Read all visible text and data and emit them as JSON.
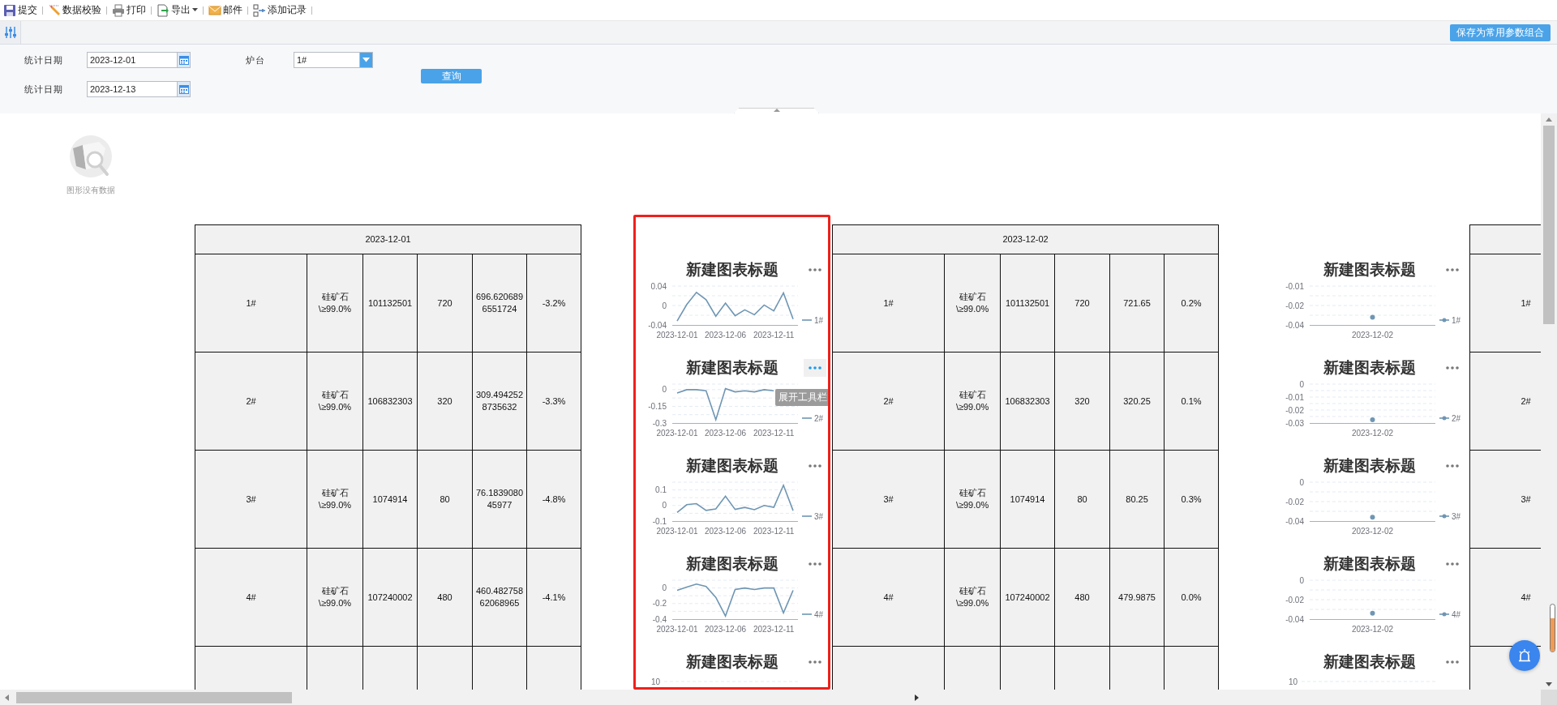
{
  "toolbar": [
    {
      "kind": "save",
      "label": "提交"
    },
    {
      "kind": "pencil",
      "label": "数据校验"
    },
    {
      "kind": "printer",
      "label": "打印"
    },
    {
      "kind": "export",
      "label": "导出",
      "dropdown": true
    },
    {
      "kind": "mail",
      "label": "邮件"
    },
    {
      "kind": "add-record",
      "label": "添加记录"
    }
  ],
  "save_preset_button": "保存为常用参数组合",
  "params": {
    "fields": [
      {
        "kind": "date",
        "label": "统计日期",
        "value": "2023-12-01"
      },
      {
        "kind": "date",
        "label": "统计日期",
        "value": "2023-12-13"
      },
      {
        "kind": "select",
        "label": "炉台",
        "value": "1#"
      }
    ],
    "query_button": "查询"
  },
  "no_data": {
    "text": "图形没有数据"
  },
  "reports": [
    {
      "kind": "table",
      "header": "2023-12-01",
      "partial_row": true,
      "rows": [
        [
          "1#",
          "硅矿石\\≥99.0%",
          "101132501",
          "720",
          "696.6206896551724",
          "-3.2%"
        ],
        [
          "2#",
          "硅矿石\\≥99.0%",
          "106832303",
          "320",
          "309.4942528735632",
          "-3.3%"
        ],
        [
          "3#",
          "硅矿石\\≥99.0%",
          "1074914",
          "80",
          "76.183908045977",
          "-4.8%"
        ],
        [
          "4#",
          "硅矿石\\≥99.0%",
          "107240002",
          "480",
          "460.48275862068965",
          "-4.1%"
        ]
      ]
    },
    {
      "kind": "charts",
      "highlighted": true,
      "charts": [
        {
          "title": "新建图表标题",
          "menu_hovered": false,
          "chart_data": {
            "type": "line",
            "categories": [
              "2023-12-01",
              null,
              null,
              null,
              null,
              "2023-12-06",
              null,
              null,
              null,
              null,
              "2023-12-11",
              null,
              null
            ],
            "ylim": [
              -0.04,
              0.04
            ],
            "yticks": [
              -0.04,
              0,
              0.04
            ],
            "series": [
              {
                "name": "1#",
                "color": "#6f96b3",
                "values": [
                  -0.032,
                  0.002,
                  0.027,
                  0.012,
                  -0.022,
                  0.005,
                  -0.021,
                  -0.009,
                  -0.019,
                  0.001,
                  -0.011,
                  0.026,
                  -0.028
                ]
              }
            ]
          }
        },
        {
          "title": "新建图表标题",
          "menu_hovered": true,
          "tooltip": "展开工具栏",
          "chart_data": {
            "type": "line",
            "categories": [
              "2023-12-01",
              null,
              null,
              null,
              null,
              "2023-12-06",
              null,
              null,
              null,
              null,
              "2023-12-11",
              null,
              null
            ],
            "ylim": [
              -0.3,
              0.05
            ],
            "yticks": [
              -0.3,
              -0.15,
              0
            ],
            "series": [
              {
                "name": "2#",
                "color": "#6f96b3",
                "values": [
                  -0.03,
                  0,
                  0,
                  -0.01,
                  -0.27,
                  0.01,
                  -0.02,
                  -0.01,
                  -0.02,
                  0,
                  -0.01,
                  null,
                  null
                ]
              }
            ]
          }
        },
        {
          "title": "新建图表标题",
          "menu_hovered": false,
          "chart_data": {
            "type": "line",
            "categories": [
              "2023-12-01",
              null,
              null,
              null,
              null,
              "2023-12-06",
              null,
              null,
              null,
              null,
              "2023-12-11",
              null,
              null
            ],
            "ylim": [
              -0.1,
              0.15
            ],
            "yticks": [
              -0.1,
              0,
              0.1
            ],
            "series": [
              {
                "name": "3#",
                "color": "#6f96b3",
                "values": [
                  -0.045,
                  0.005,
                  0.012,
                  -0.032,
                  -0.022,
                  0.06,
                  -0.025,
                  -0.012,
                  -0.027,
                  0,
                  -0.012,
                  0.13,
                  -0.033
                ]
              }
            ]
          }
        },
        {
          "title": "新建图表标题",
          "menu_hovered": false,
          "chart_data": {
            "type": "line",
            "categories": [
              "2023-12-01",
              null,
              null,
              null,
              null,
              "2023-12-06",
              null,
              null,
              null,
              null,
              "2023-12-11",
              null,
              null
            ],
            "ylim": [
              -0.4,
              0.1
            ],
            "yticks": [
              -0.4,
              -0.2,
              0
            ],
            "series": [
              {
                "name": "4#",
                "color": "#6f96b3",
                "values": [
                  -0.03,
                  0.01,
                  0.05,
                  0.02,
                  -0.12,
                  -0.36,
                  -0.02,
                  0,
                  -0.02,
                  0,
                  0,
                  -0.32,
                  -0.03
                ]
              }
            ]
          }
        },
        {
          "title": "新建图表标题",
          "menu_hovered": false,
          "top_tick": "10"
        }
      ]
    },
    {
      "kind": "table",
      "header": "2023-12-02",
      "partial_row": true,
      "rows": [
        [
          "1#",
          "硅矿石\\≥99.0%",
          "101132501",
          "720",
          "721.65",
          "0.2%"
        ],
        [
          "2#",
          "硅矿石\\≥99.0%",
          "106832303",
          "320",
          "320.25",
          "0.1%"
        ],
        [
          "3#",
          "硅矿石\\≥99.0%",
          "1074914",
          "80",
          "80.25",
          "0.3%"
        ],
        [
          "4#",
          "硅矿石\\≥99.0%",
          "107240002",
          "480",
          "479.9875",
          "0.0%"
        ]
      ]
    },
    {
      "kind": "charts",
      "charts": [
        {
          "title": "新建图表标题",
          "menu_hovered": false,
          "chart_data": {
            "type": "line",
            "categories": [
              "2023-12-02"
            ],
            "ylim": [
              -0.04,
              -0.01
            ],
            "yticks": [
              {
                "value": -0.04,
                "label": "-0.04"
              },
              {
                "value": -0.025,
                "label": "-0.02"
              },
              {
                "value": -0.01,
                "label": "-0.01"
              }
            ],
            "series": [
              {
                "name": "1#",
                "color": "#6f96b3",
                "marker": "circle",
                "values": [
                  -0.034
                ]
              }
            ]
          }
        },
        {
          "title": "新建图表标题",
          "menu_hovered": false,
          "chart_data": {
            "type": "line",
            "categories": [
              "2023-12-02"
            ],
            "ylim": [
              -0.03,
              0
            ],
            "yticks": [
              -0.03,
              -0.02,
              -0.01,
              0
            ],
            "series": [
              {
                "name": "2#",
                "color": "#6f96b3",
                "marker": "circle",
                "values": [
                  -0.0275
                ]
              }
            ]
          }
        },
        {
          "title": "新建图表标题",
          "menu_hovered": false,
          "chart_data": {
            "type": "line",
            "categories": [
              "2023-12-02"
            ],
            "ylim": [
              -0.04,
              0
            ],
            "yticks": [
              -0.04,
              -0.02,
              0
            ],
            "series": [
              {
                "name": "3#",
                "color": "#6f96b3",
                "marker": "circle",
                "values": [
                  -0.036
                ]
              }
            ]
          }
        },
        {
          "title": "新建图表标题",
          "menu_hovered": false,
          "chart_data": {
            "type": "line",
            "categories": [
              "2023-12-02"
            ],
            "ylim": [
              -0.04,
              0
            ],
            "yticks": [
              -0.04,
              -0.02,
              0
            ],
            "series": [
              {
                "name": "4#",
                "color": "#6f96b3",
                "marker": "circle",
                "values": [
                  -0.034
                ]
              }
            ]
          }
        },
        {
          "title": "新建图表标题",
          "menu_hovered": false,
          "top_tick": "10"
        }
      ]
    },
    {
      "kind": "table",
      "partial_row": true,
      "rows": [
        [
          "1#"
        ],
        [
          "2#"
        ],
        [
          "3#"
        ],
        [
          "4#"
        ]
      ]
    }
  ]
}
